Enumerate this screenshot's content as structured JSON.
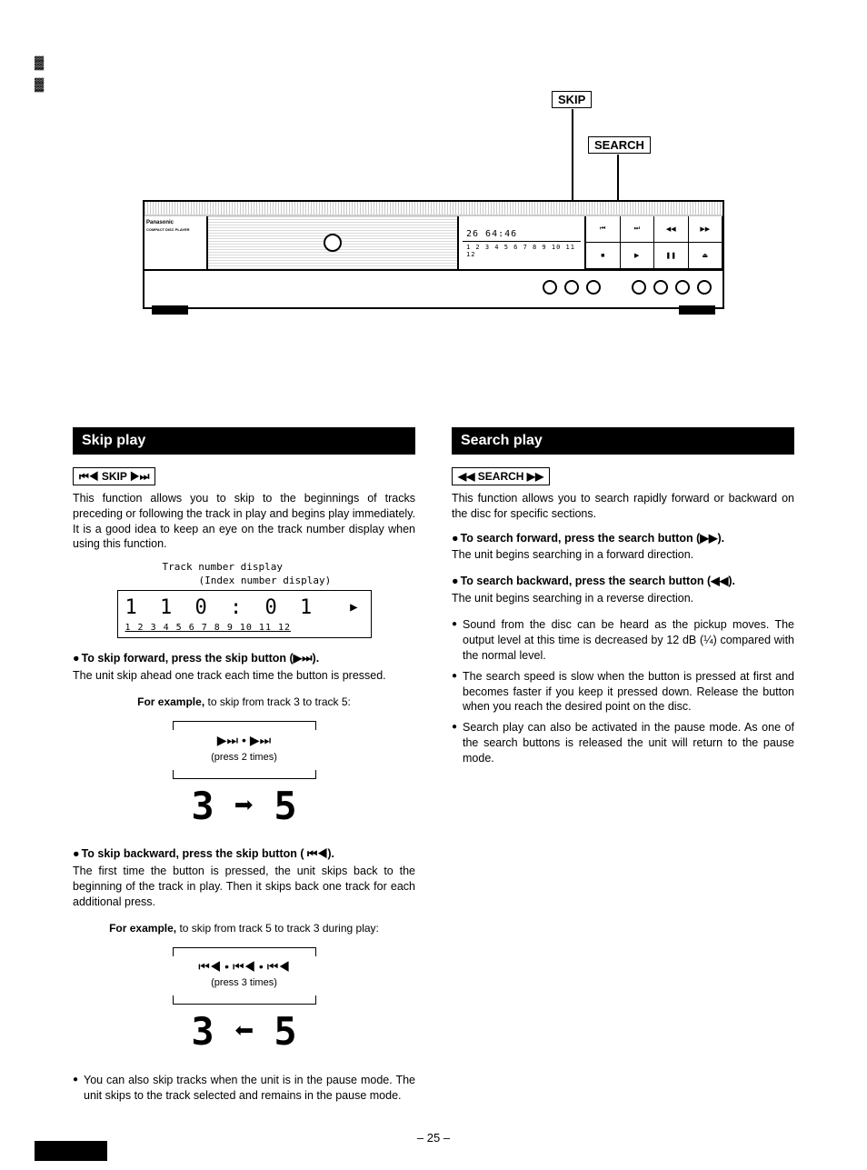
{
  "callouts": {
    "skip": "SKIP",
    "search": "SEARCH"
  },
  "device": {
    "brand": "Panasonic",
    "subtitle": "COMPACT DISC PLAYER",
    "lcd_main": "26   64:46",
    "lcd_tracks": "1 2 3 4 5 6 7 8 9 10 11 12"
  },
  "skip": {
    "title": "Skip play",
    "button_label": "⏮◀ SKIP ▶⏭",
    "intro": "This function allows you to skip to the beginnings of tracks preceding or following the track in play and begins play immediately. It is a good idea to keep an eye on the track number display when using this function.",
    "display_label1": "Track number display",
    "display_label2": "(Index number display)",
    "display_row1": "1   1    0 : 0 1",
    "display_row2": "1 2 3 4 5 6 7 8 9 10 11 12",
    "fwd_head": "To skip forward, press the skip button (▶⏭).",
    "fwd_sub": "The unit skip ahead one track each time the button is pressed.",
    "fwd_example_lead": "For example,",
    "fwd_example_tail": " to skip from track 3 to track 5:",
    "fwd_icons": "▶⏭ • ▶⏭",
    "fwd_press": "(press 2 times)",
    "fwd_from": "3",
    "fwd_to": "5",
    "bwd_head": "To skip backward, press the skip button ( ⏮◀).",
    "bwd_sub": "The first time the button is pressed, the unit skips back to the beginning of the track in play. Then it skips back one track for each additional press.",
    "bwd_example_lead": "For example,",
    "bwd_example_tail": " to skip from track 5 to track 3 during play:",
    "bwd_icons": "⏮◀ • ⏮◀ • ⏮◀",
    "bwd_press": "(press 3 times)",
    "bwd_from": "3",
    "bwd_to": "5",
    "pause_note": "You can also skip tracks when the unit is in the pause mode. The unit skips to the track selected and remains in the pause mode."
  },
  "search": {
    "title": "Search play",
    "button_label": "◀◀ SEARCH ▶▶",
    "intro": "This function allows you to search rapidly forward or backward on the disc for specific sections.",
    "fwd_head": "To search forward, press the search button (▶▶).",
    "fwd_sub": "The unit begins searching in a forward direction.",
    "bwd_head": "To search backward, press the search button (◀◀).",
    "bwd_sub": "The unit begins searching in a reverse direction.",
    "notes": [
      "Sound from the disc can be heard as the pickup moves. The output level at this time is decreased by 12 dB (¼) compared with the normal level.",
      "The search speed is slow when the button is pressed at first and becomes faster if you keep it pressed down. Release the button when you reach the desired point on the disc.",
      "Search play can also be activated in the pause mode. As one of the search buttons is released the unit will return to the pause mode."
    ]
  },
  "page_number": "– 25 –"
}
